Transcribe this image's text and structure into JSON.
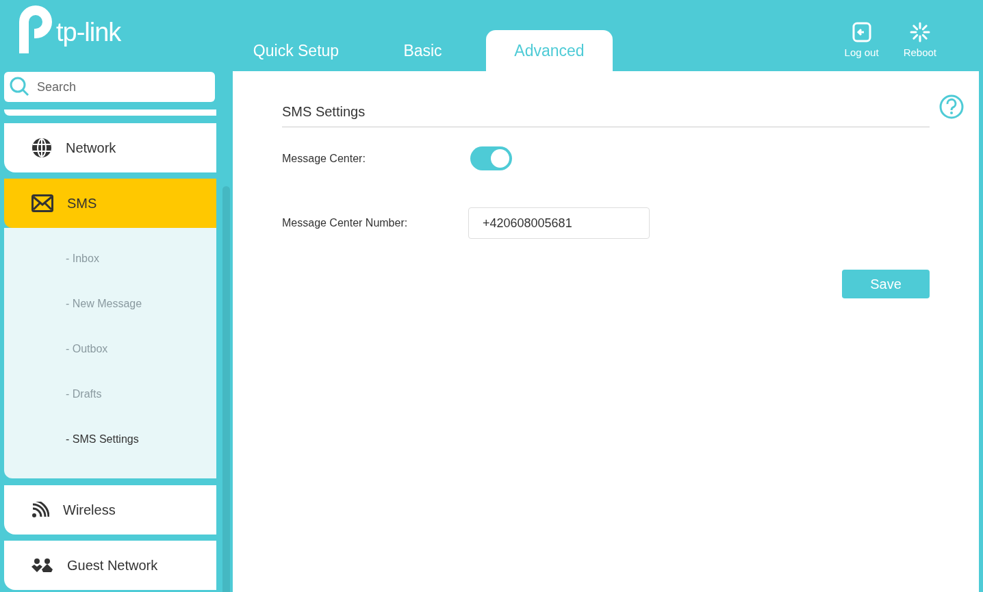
{
  "logo": {
    "text": "tp-link"
  },
  "tabs": [
    {
      "label": "Quick Setup",
      "selected": false
    },
    {
      "label": "Basic",
      "selected": false
    },
    {
      "label": "Advanced",
      "selected": true
    }
  ],
  "actions": [
    {
      "kind": "logout",
      "label": "Log out"
    },
    {
      "kind": "reboot",
      "label": "Reboot"
    }
  ],
  "sidebar": {
    "search": {
      "placeholder": "Search"
    },
    "items": [
      {
        "kind": "network",
        "label": "Network",
        "selected": false
      },
      {
        "kind": "sms",
        "label": "SMS",
        "selected": true,
        "children": [
          {
            "label": "- Inbox",
            "selected": false
          },
          {
            "label": "- New Message",
            "selected": false
          },
          {
            "label": "- Outbox",
            "selected": false
          },
          {
            "label": "- Drafts",
            "selected": false
          },
          {
            "label": "- SMS Settings",
            "selected": true
          }
        ]
      },
      {
        "kind": "wireless",
        "label": "Wireless",
        "selected": false
      },
      {
        "kind": "guest",
        "label": "Guest Network",
        "selected": false
      }
    ]
  },
  "panel": {
    "title": "SMS Settings",
    "fields": [
      {
        "kind": "toggle",
        "label": "Message Center:",
        "on": true
      },
      {
        "kind": "text",
        "label": "Message Center Number:",
        "value": "+420608005681"
      }
    ],
    "save": "Save"
  }
}
